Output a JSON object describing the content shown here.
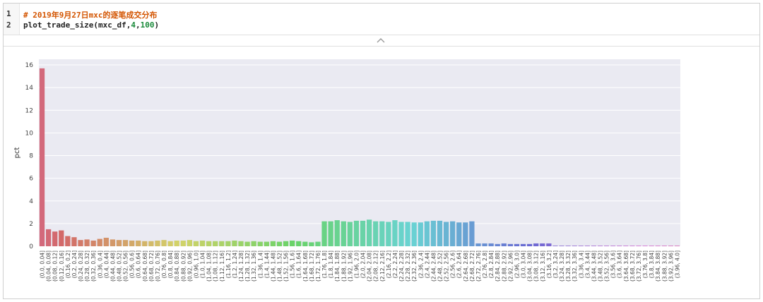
{
  "cell": {
    "lines": [
      {
        "num": "1",
        "text": "# 2019年9月27日mxc的逐笔成交分布"
      },
      {
        "num": "2",
        "text_pre": "plot_trade_size(mxc_df,",
        "arg1": "4",
        "sep": ",",
        "arg2": "100",
        "text_post": ")"
      }
    ]
  },
  "colors": {
    "plot_bg": "#eaeaf2",
    "grid": "#ffffff",
    "comment": "#d35400",
    "number": "#1a8a3a"
  },
  "chart_data": {
    "type": "bar",
    "xlabel": "",
    "ylabel": "pct",
    "ylim": [
      0,
      16.5
    ],
    "yticks": [
      0,
      2,
      4,
      6,
      8,
      10,
      12,
      14,
      16
    ],
    "grid": true,
    "categories": [
      "(0.0, 0.04]",
      "(0.04, 0.08]",
      "(0.08, 0.12]",
      "(0.12, 0.16]",
      "(0.16, 0.2]",
      "(0.2, 0.24]",
      "(0.24, 0.28]",
      "(0.28, 0.32]",
      "(0.32, 0.36]",
      "(0.36, 0.4]",
      "(0.4, 0.44]",
      "(0.44, 0.48]",
      "(0.48, 0.52]",
      "(0.52, 0.56]",
      "(0.56, 0.6]",
      "(0.6, 0.64]",
      "(0.64, 0.68]",
      "(0.68, 0.72]",
      "(0.72, 0.76]",
      "(0.76, 0.8]",
      "(0.8, 0.84]",
      "(0.84, 0.88]",
      "(0.88, 0.92]",
      "(0.92, 0.96]",
      "(0.96, 1.0]",
      "(1.0, 1.04]",
      "(1.04, 1.08]",
      "(1.08, 1.12]",
      "(1.12, 1.16]",
      "(1.16, 1.2]",
      "(1.2, 1.24]",
      "(1.24, 1.28]",
      "(1.28, 1.32]",
      "(1.32, 1.36]",
      "(1.36, 1.4]",
      "(1.4, 1.44]",
      "(1.44, 1.48]",
      "(1.48, 1.52]",
      "(1.52, 1.56]",
      "(1.56, 1.6]",
      "(1.6, 1.64]",
      "(1.64, 1.68]",
      "(1.68, 1.72]",
      "(1.72, 1.76]",
      "(1.76, 1.8]",
      "(1.8, 1.84]",
      "(1.84, 1.88]",
      "(1.88, 1.92]",
      "(1.92, 1.96]",
      "(1.96, 2.0]",
      "(2.0, 2.04]",
      "(2.04, 2.08]",
      "(2.08, 2.12]",
      "(2.12, 2.16]",
      "(2.16, 2.2]",
      "(2.2, 2.24]",
      "(2.24, 2.28]",
      "(2.28, 2.32]",
      "(2.32, 2.36]",
      "(2.36, 2.4]",
      "(2.4, 2.44]",
      "(2.44, 2.48]",
      "(2.48, 2.52]",
      "(2.52, 2.56]",
      "(2.56, 2.6]",
      "(2.6, 2.64]",
      "(2.64, 2.68]",
      "(2.68, 2.72]",
      "(2.72, 2.76]",
      "(2.76, 2.8]",
      "(2.8, 2.84]",
      "(2.84, 2.88]",
      "(2.88, 2.92]",
      "(2.92, 2.96]",
      "(2.96, 3.0]",
      "(3.0, 3.04]",
      "(3.04, 3.08]",
      "(3.08, 3.12]",
      "(3.12, 3.16]",
      "(3.16, 3.2]",
      "(3.2, 3.24]",
      "(3.24, 3.28]",
      "(3.28, 3.32]",
      "(3.32, 3.36]",
      "(3.36, 3.4]",
      "(3.4, 3.44]",
      "(3.44, 3.48]",
      "(3.48, 3.52]",
      "(3.52, 3.56]",
      "(3.56, 3.6]",
      "(3.6, 3.64]",
      "(3.64, 3.68]",
      "(3.68, 3.72]",
      "(3.72, 3.76]",
      "(3.76, 3.8]",
      "(3.8, 3.84]",
      "(3.84, 3.88]",
      "(3.88, 3.92]",
      "(3.92, 3.96]",
      "(3.96, 4.0]"
    ],
    "values": [
      15.7,
      1.5,
      1.3,
      1.4,
      0.9,
      0.8,
      0.55,
      0.6,
      0.5,
      0.65,
      0.75,
      0.6,
      0.55,
      0.55,
      0.5,
      0.5,
      0.45,
      0.45,
      0.5,
      0.55,
      0.45,
      0.5,
      0.5,
      0.55,
      0.45,
      0.5,
      0.45,
      0.45,
      0.45,
      0.45,
      0.5,
      0.45,
      0.4,
      0.45,
      0.4,
      0.4,
      0.45,
      0.4,
      0.45,
      0.5,
      0.45,
      0.4,
      0.35,
      0.4,
      2.2,
      2.2,
      2.3,
      2.2,
      2.15,
      2.25,
      2.25,
      2.35,
      2.2,
      2.2,
      2.15,
      2.3,
      2.15,
      2.15,
      2.1,
      2.1,
      2.2,
      2.25,
      2.25,
      2.15,
      2.2,
      2.1,
      2.1,
      2.2,
      0.25,
      0.25,
      0.25,
      0.2,
      0.25,
      0.2,
      0.2,
      0.2,
      0.2,
      0.25,
      0.25,
      0.25,
      0.05,
      0.05,
      0.05,
      0.05,
      0.05,
      0.05,
      0.05,
      0.05,
      0.05,
      0.05,
      0.05,
      0.05,
      0.05,
      0.05,
      0.05,
      0.05,
      0.05,
      0.05,
      0.05,
      0.05
    ]
  }
}
